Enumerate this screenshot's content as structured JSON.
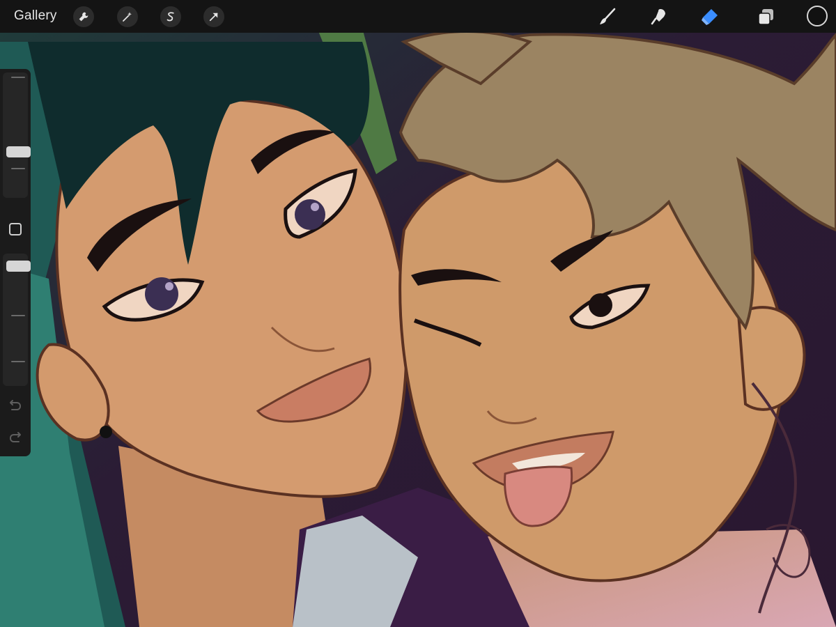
{
  "toolbar": {
    "gallery_label": "Gallery",
    "actions": [
      {
        "name": "actions",
        "icon": "wrench-icon"
      },
      {
        "name": "adjustments",
        "icon": "magic-wand-icon"
      },
      {
        "name": "selection",
        "icon": "selection-s-icon"
      },
      {
        "name": "transform",
        "icon": "arrow-cursor-icon"
      }
    ],
    "tools": [
      {
        "name": "brush",
        "icon": "brush-icon",
        "active": false
      },
      {
        "name": "smudge",
        "icon": "smudge-finger-icon",
        "active": false
      },
      {
        "name": "eraser",
        "icon": "eraser-icon",
        "active": true
      },
      {
        "name": "layers",
        "icon": "layers-icon",
        "active": false
      }
    ],
    "current_color": "#111111",
    "accent_color": "#3a8dff"
  },
  "sidebar": {
    "brush_size_level": 0.45,
    "opacity_level": 0.88,
    "modify_icon": "square-icon",
    "undo_icon": "undo-arrow-icon",
    "redo_icon": "redo-arrow-icon"
  },
  "canvas": {
    "subject": "illustration-canvas"
  }
}
